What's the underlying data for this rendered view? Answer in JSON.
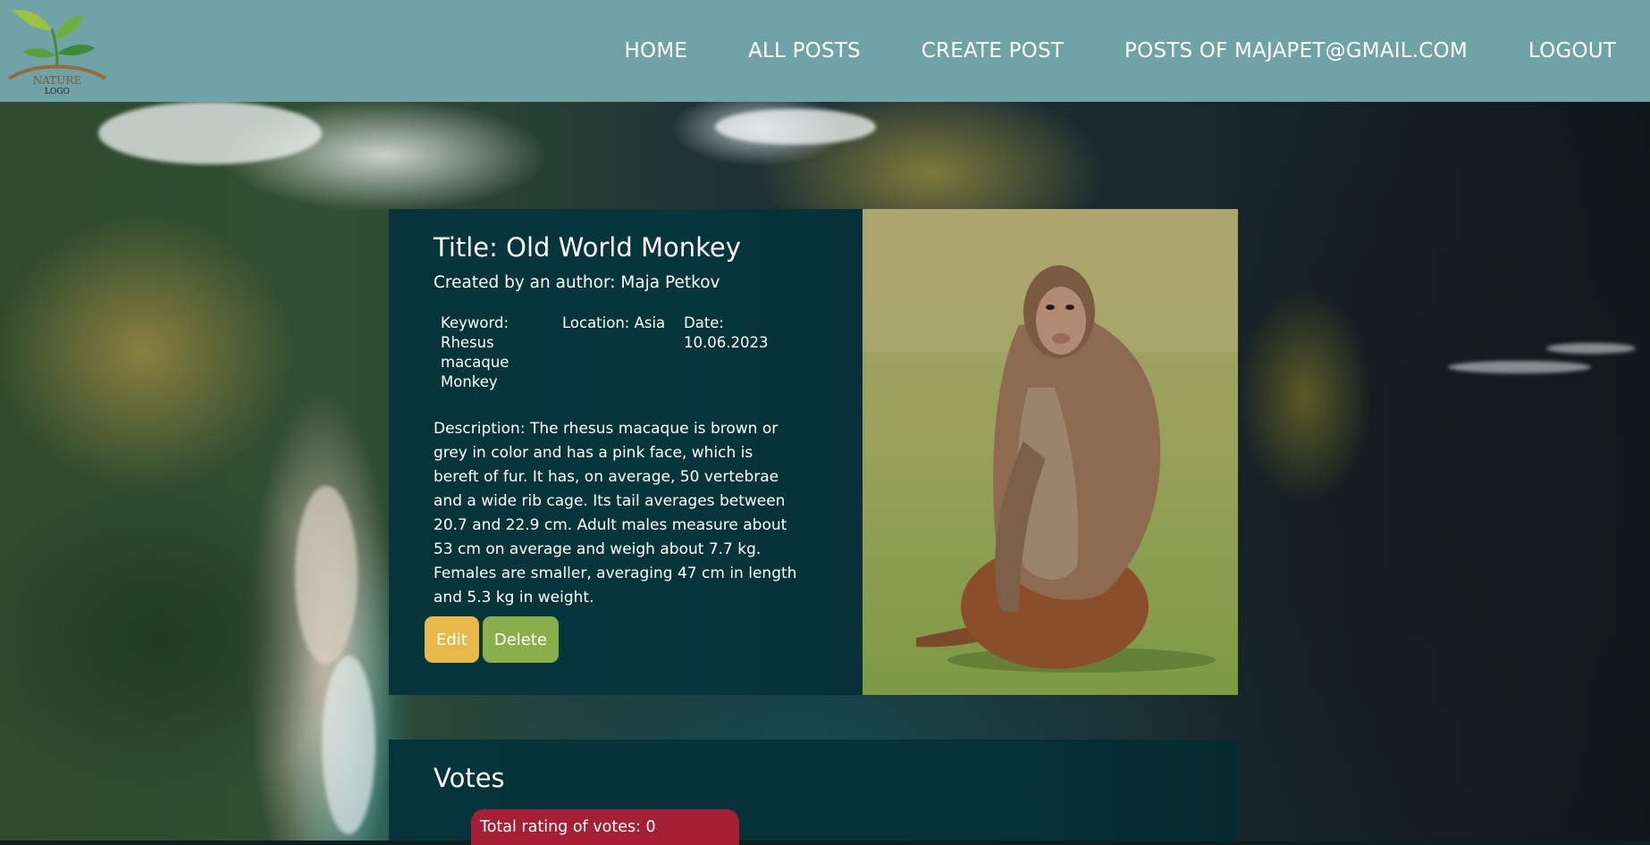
{
  "header": {
    "logo_text_main": "NATURE",
    "logo_text_sub": "LOGO",
    "nav": [
      {
        "label": "HOME"
      },
      {
        "label": "ALL POSTS"
      },
      {
        "label": "CREATE POST"
      },
      {
        "label": "POSTS OF MAJAPET@GMAIL.COM"
      },
      {
        "label": "LOGOUT"
      }
    ]
  },
  "post": {
    "title": "Title: Old World Monkey",
    "author": "Created by an author: Maja Petkov",
    "keyword": "Keyword: Rhesus macaque Monkey",
    "location": "Location: Asia",
    "date": "Date: 10.06.2023",
    "description": "Description: The rhesus macaque is brown or grey in color and has a pink face, which is bereft of fur. It has, on average, 50 vertebrae and a wide rib cage. Its tail averages between 20.7 and 22.9 cm. Adult males measure about 53 cm on average and weigh about 7.7 kg. Females are smaller, averaging 47 cm in length and 5.3 kg in weight.",
    "edit_label": "Edit",
    "delete_label": "Delete",
    "edit_color": "#e7b949",
    "delete_color": "#8aae4a"
  },
  "votes": {
    "heading": "Votes",
    "total": "Total rating of votes: 0",
    "rating_color": "#a61f35"
  },
  "colors": {
    "header_bg": "#6fa3a8",
    "card_bg": "#06343b"
  }
}
